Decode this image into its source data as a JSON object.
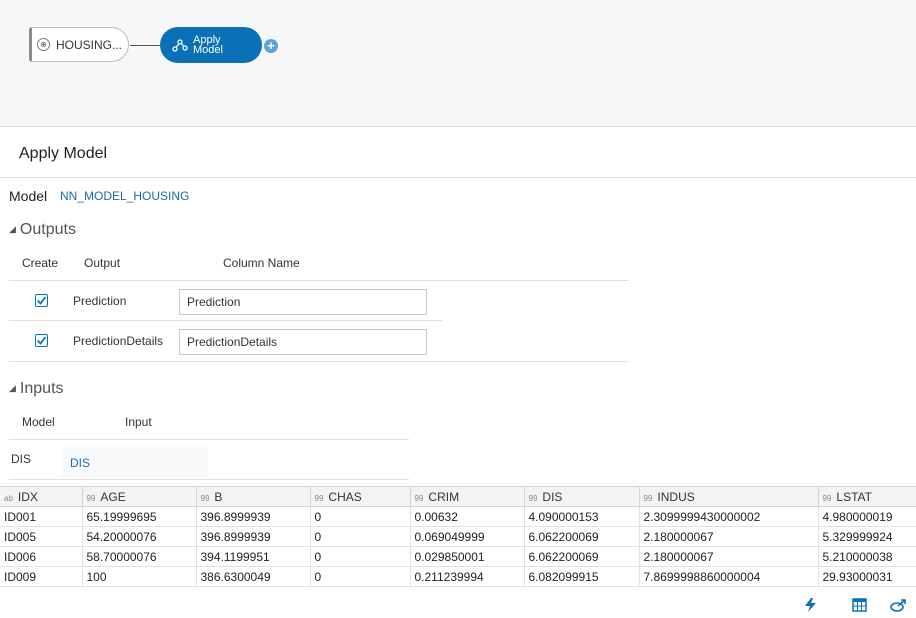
{
  "workflow": {
    "source_node": "HOUSING...",
    "apply_node": "Apply Model",
    "apply_line1": "Apply",
    "apply_line2": "Model"
  },
  "panel": {
    "title": "Apply Model",
    "model_label": "Model",
    "model_value": "NN_MODEL_HOUSING"
  },
  "outputs": {
    "section_title": "Outputs",
    "headers": {
      "create": "Create",
      "output": "Output",
      "column_name": "Column Name"
    },
    "rows": [
      {
        "checked": true,
        "output": "Prediction",
        "column_name": "Prediction"
      },
      {
        "checked": true,
        "output": "PredictionDetails",
        "column_name": "PredictionDetails"
      }
    ]
  },
  "inputs": {
    "section_title": "Inputs",
    "headers": {
      "model": "Model",
      "input": "Input"
    },
    "rows": [
      {
        "model": "DIS",
        "input": "DIS"
      }
    ]
  },
  "grid": {
    "columns": [
      {
        "type": "ab",
        "name": "IDX"
      },
      {
        "type": "99",
        "name": "AGE"
      },
      {
        "type": "99",
        "name": "B"
      },
      {
        "type": "99",
        "name": "CHAS"
      },
      {
        "type": "99",
        "name": "CRIM"
      },
      {
        "type": "99",
        "name": "DIS"
      },
      {
        "type": "99",
        "name": "INDUS"
      },
      {
        "type": "99",
        "name": "LSTAT"
      }
    ],
    "rows": [
      [
        "ID001",
        "65.19999695",
        "396.8999939",
        "0",
        "0.00632",
        "4.090000153",
        "2.3099999430000002",
        "4.980000019"
      ],
      [
        "ID005",
        "54.20000076",
        "396.8999939",
        "0",
        "0.069049999",
        "6.062200069",
        "2.180000067",
        "5.329999924"
      ],
      [
        "ID006",
        "58.70000076",
        "394.1199951",
        "0",
        "0.029850001",
        "6.062200069",
        "2.180000067",
        "5.210000038"
      ],
      [
        "ID009",
        "100",
        "386.6300049",
        "0",
        "0.211239994",
        "6.082099915",
        "7.8699998860000004",
        "29.93000031"
      ]
    ]
  },
  "toolbar": {
    "icons": [
      "refresh-lightning-icon",
      "table-icon",
      "link-icon"
    ]
  },
  "colors": {
    "accent": "#0a70b8",
    "link": "#1a6ea8"
  }
}
